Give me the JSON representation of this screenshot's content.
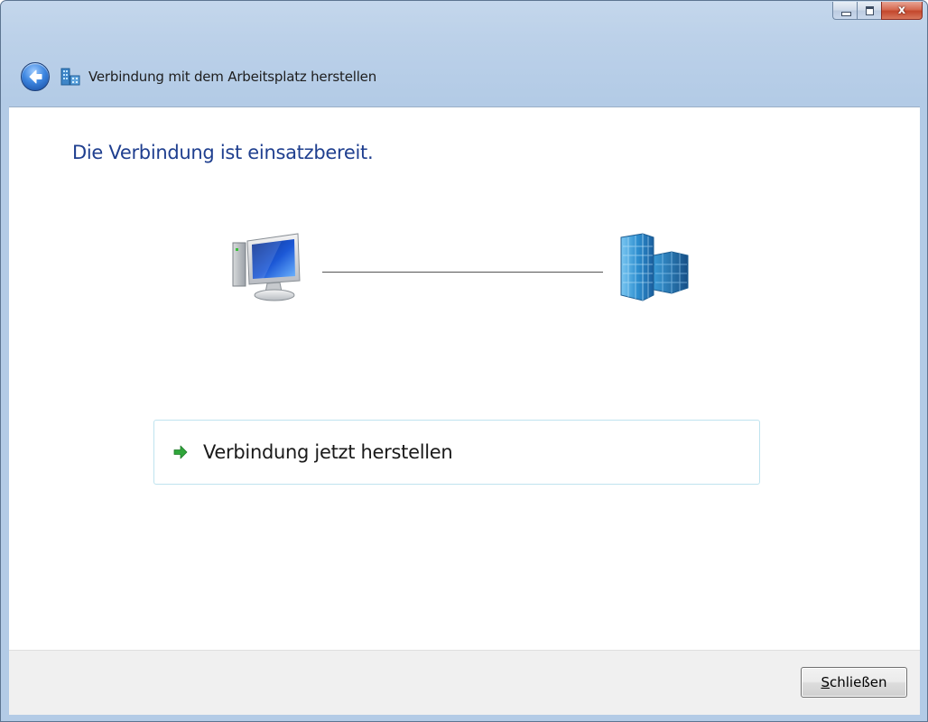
{
  "window": {
    "title": "Verbindung mit dem Arbeitsplatz herstellen",
    "icon": "workplace-network-icon"
  },
  "caption_buttons": {
    "minimize_icon": "minimize-icon",
    "maximize_icon": "maximize-icon",
    "close_icon": "close-icon",
    "close_glyph": "x"
  },
  "nav": {
    "back_icon": "back-arrow-icon"
  },
  "content": {
    "heading": "Die Verbindung ist einsatzbereit.",
    "diagram": {
      "left_icon": "computer-icon",
      "right_icon": "office-building-icon"
    },
    "option": {
      "icon": "green-arrow-icon",
      "label": "Verbindung jetzt herstellen"
    }
  },
  "footer": {
    "close_label_accel": "S",
    "close_label_rest": "chließen"
  },
  "colors": {
    "heading": "#1f3f8f",
    "title_bar": "#bcd1e9",
    "option_border": "#bfe3ef",
    "footer_bg": "#f0f0f0"
  }
}
